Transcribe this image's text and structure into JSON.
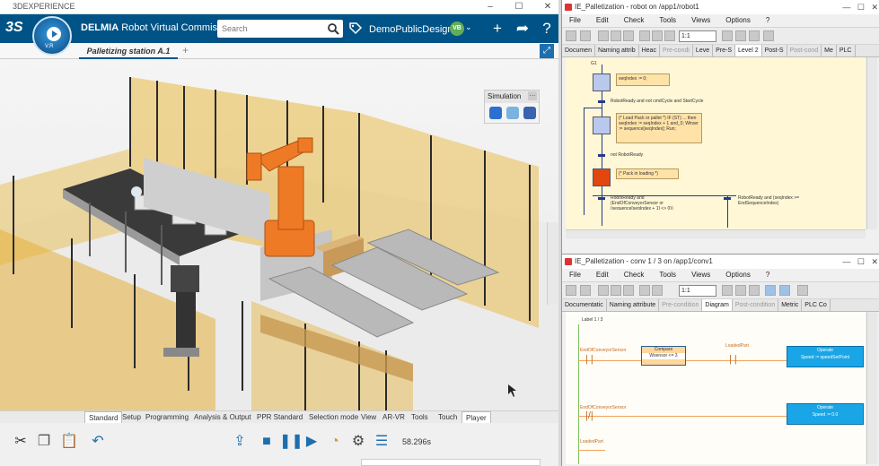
{
  "left_window": {
    "titlebar": "3DEXPERIENCE",
    "compass_version": "V.R",
    "brand": "DELMIA",
    "app_title": "Robot Virtual Commiss...",
    "search_placeholder": "Search",
    "collab_space": "DemoPublicDesign",
    "avatar_initials": "VB",
    "tab_label": "Palletizing station A.1",
    "simulation_panel_title": "Simulation",
    "bottom_tabs": [
      "Standard",
      "Setup",
      "Programming",
      "Analysis & Output",
      "PPR Standard",
      "Selection mode",
      "View",
      "AR-VR",
      "Tools",
      "Touch",
      "Player"
    ],
    "time_readout": "58.296s"
  },
  "win1": {
    "title": "IE_Palletization - robot on /app1/robot1",
    "menu": [
      "File",
      "Edit",
      "Check",
      "Tools",
      "Views",
      "Options",
      "?"
    ],
    "zoom": "1:1",
    "tabs": [
      {
        "label": "Documen",
        "state": "normal"
      },
      {
        "label": "Naming attrib",
        "state": "normal"
      },
      {
        "label": "Heac",
        "state": "normal"
      },
      {
        "label": "Pre-condi",
        "state": "dim"
      },
      {
        "label": "Leve",
        "state": "normal"
      },
      {
        "label": "Pre-S",
        "state": "normal"
      },
      {
        "label": "Level 2",
        "state": "act"
      },
      {
        "label": "Post-S",
        "state": "normal"
      },
      {
        "label": "Post-cond",
        "state": "dim"
      },
      {
        "label": "Me",
        "state": "normal"
      },
      {
        "label": "PLC",
        "state": "normal"
      }
    ],
    "sfc": {
      "step_top": "G1",
      "action1": "seqIndex := 0;",
      "trans1": "RobotReady and not cmdCycle and StartCycle",
      "action2": "(* Load Pack or pallet *) IF (ST) ... then seqIndex := seqIndex + 1 and_0; Wtravr := sequence[seqIndex]; Run;",
      "trans2": "not RobotReady",
      "action3": "(* Pack in loading *)",
      "trans3": "RobotReady and (EndOfConveyorSensor or (sequence[seqIndex + 1] <> 0)) and (seqIndex < EndSequenceIndex)",
      "trans4": "RobotReady and (seqIndex >= EndSequenceIndex)"
    }
  },
  "win2": {
    "title": "IE_Palletization - conv 1 / 3 on /app1/conv1",
    "menu": [
      "File",
      "Edit",
      "Check",
      "Tools",
      "Views",
      "Options",
      "?"
    ],
    "zoom": "1:1",
    "tabs": [
      {
        "label": "Documentatic",
        "state": "normal"
      },
      {
        "label": "Naming attribute",
        "state": "normal"
      },
      {
        "label": "Pre-condition",
        "state": "dim"
      },
      {
        "label": "Diagram",
        "state": "act"
      },
      {
        "label": "Post-condition",
        "state": "dim"
      },
      {
        "label": "Metric",
        "state": "normal"
      },
      {
        "label": "PLC Co",
        "state": "normal"
      }
    ],
    "ladder": {
      "header": "Label 1 / 3",
      "contact1": "EndOfConveyorSensor",
      "compare_title": "Compare",
      "compare_expr": "Wsensor <= 3",
      "contact2": "LoadedPart",
      "coil1_title": "Operate",
      "coil1_expr": "Speed := speedSetPoint",
      "contact3": "EndOfConveyorSensor",
      "coil2_title": "Operate",
      "coil2_expr": "Speed := 0.0",
      "contact4": "LoadedPart"
    }
  }
}
